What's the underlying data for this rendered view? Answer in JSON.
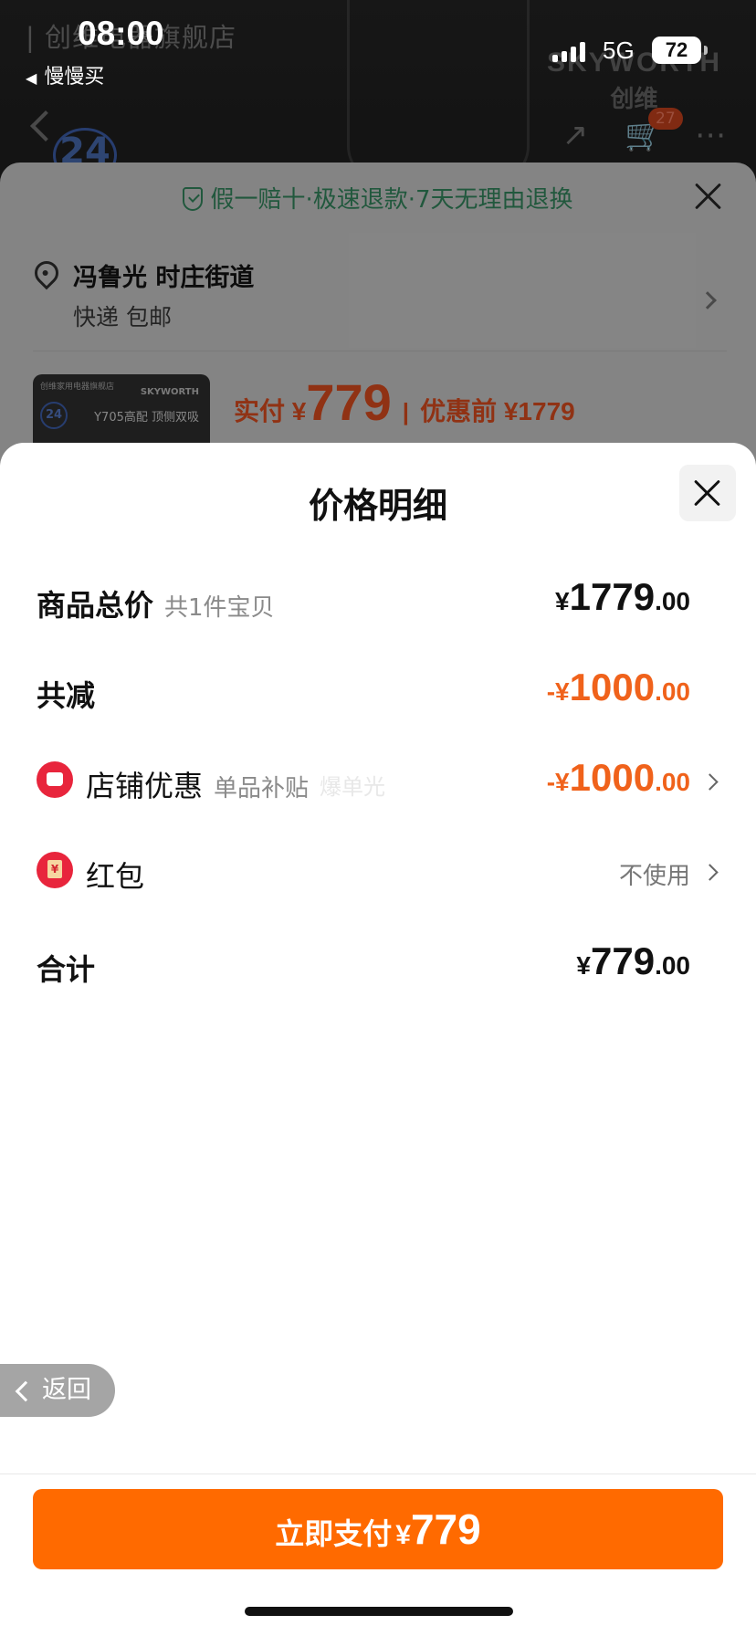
{
  "status_bar": {
    "time": "08:00",
    "back_app": "慢慢买",
    "network": "5G",
    "battery": "72"
  },
  "background_page": {
    "store_name": "| 创维电器旗舰店",
    "brand_en": "SKYWORTH",
    "brand_cn": "创维",
    "badge": "24",
    "cart_count": "27",
    "icons": [
      "share-icon",
      "cart-icon",
      "more-icon"
    ]
  },
  "order_sheet": {
    "guarantee": "假一赔十·极速退款·7天无理由退换",
    "address_name": "冯鲁光 时庄街道",
    "shipping": "快递 包邮",
    "thumb_store": "创维家用电器旗舰店",
    "thumb_brand": "SKYWORTH",
    "thumb_model": "Y705高配 顶侧双吸",
    "thumb_badge": "24",
    "paid_label": "实付 ¥",
    "paid_amount": "779",
    "separator": "|",
    "pre_discount": "优惠前 ¥1779"
  },
  "modal": {
    "title": "价格明细",
    "rows": {
      "total": {
        "label": "商品总价",
        "sub": "共1件宝贝",
        "yen": "¥",
        "int": "1779",
        "dec": ".00"
      },
      "reduced": {
        "label": "共减",
        "yen": "-¥",
        "int": "1000",
        "dec": ".00"
      },
      "shop_discount": {
        "label": "店铺优惠",
        "sub": "单品补贴",
        "yen": "-¥",
        "int": "1000",
        "dec": ".00"
      },
      "red_packet": {
        "label": "红包",
        "value": "不使用"
      },
      "sum": {
        "label": "合计",
        "yen": "¥",
        "int": "779",
        "dec": ".00"
      }
    },
    "watermark": "爆单光"
  },
  "back_button": "返回",
  "pay_button": {
    "label": "立即支付",
    "yen": "¥",
    "amount": "779"
  },
  "colors": {
    "accent_orange": "#f0621b",
    "pay_button": "#ff6a00",
    "guarantee_green": "#2f7a55",
    "icon_red": "#e8253c"
  }
}
